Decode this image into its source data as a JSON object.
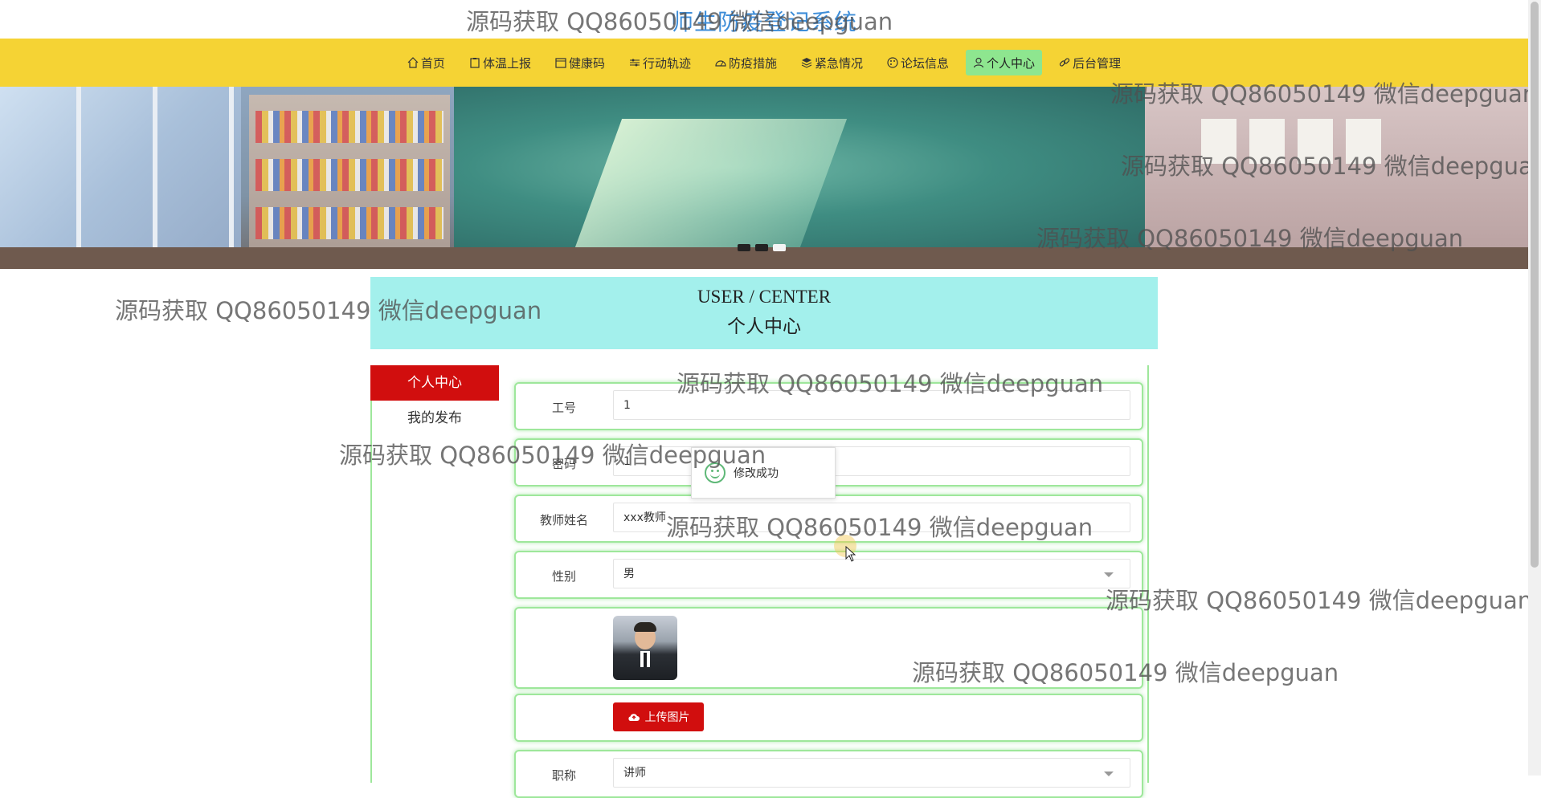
{
  "site": {
    "title": "师生防疫登记系统"
  },
  "nav": [
    {
      "label": "首页",
      "icon": "home-icon"
    },
    {
      "label": "体温上报",
      "icon": "clipboard-icon"
    },
    {
      "label": "健康码",
      "icon": "calendar-icon"
    },
    {
      "label": "行动轨迹",
      "icon": "sliders-icon"
    },
    {
      "label": "防疫措施",
      "icon": "gauge-icon"
    },
    {
      "label": "紧急情况",
      "icon": "layers-icon"
    },
    {
      "label": "论坛信息",
      "icon": "palette-icon"
    },
    {
      "label": "个人中心",
      "icon": "user-icon",
      "active": true
    },
    {
      "label": "后台管理",
      "icon": "link-icon"
    }
  ],
  "carousel": {
    "slide_count": 3,
    "active_index": 2
  },
  "user_center": {
    "title_en": "USER / CENTER",
    "title_cn": "个人中心"
  },
  "sidebar": {
    "items": [
      {
        "label": "个人中心",
        "active": true
      },
      {
        "label": "我的发布"
      }
    ]
  },
  "form": {
    "job_no": {
      "label": "工号",
      "value": "1"
    },
    "password": {
      "label": "密码",
      "value": "1"
    },
    "teacher_name": {
      "label": "教师姓名",
      "value": "xxx教师"
    },
    "gender": {
      "label": "性别",
      "value": "男"
    },
    "upload_label": "上传图片",
    "title": {
      "label": "职称",
      "value": "讲师"
    }
  },
  "toast": {
    "message": "修改成功"
  },
  "watermark": "源码获取 QQ86050149 微信deepguan",
  "colors": {
    "nav_bg": "#f5d334",
    "nav_active": "#8ee68f",
    "accent_red": "#d10e0e",
    "header_bg": "#a3f0ec",
    "row_border": "#9ee79b"
  }
}
